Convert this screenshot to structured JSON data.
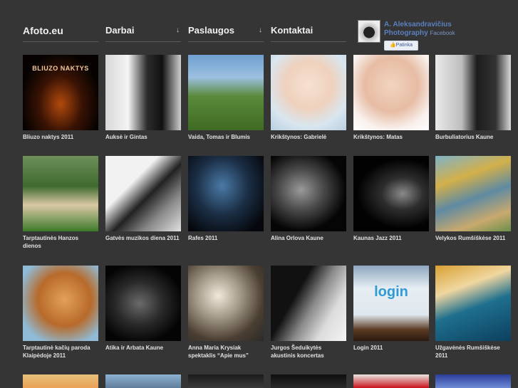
{
  "nav": {
    "logo": "Afoto.eu",
    "items": [
      {
        "label": "Darbai",
        "arrow": "↓"
      },
      {
        "label": "Paslaugos",
        "arrow": "↓"
      },
      {
        "label": "Kontaktai",
        "arrow": ""
      }
    ]
  },
  "facebook": {
    "name": "A. Aleksandravičius Photography",
    "source": "Facebook",
    "like_label": "Patinka"
  },
  "thumb_overlays": {
    "bliuzo": "BLIUZO NAKTYS",
    "login": "login"
  },
  "gallery": [
    {
      "caption": "Bliuzo naktys 2011"
    },
    {
      "caption": "Auksė ir Gintas"
    },
    {
      "caption": "Vaida, Tomas ir Blumis"
    },
    {
      "caption": "Krikštynos: Gabrielė"
    },
    {
      "caption": "Krikštynos: Matas"
    },
    {
      "caption": "Burbuliatorius Kaune"
    },
    {
      "caption": "Tarptautinės Hanzos dienos"
    },
    {
      "caption": "Gatvės muzikos diena 2011"
    },
    {
      "caption": "Rafes 2011"
    },
    {
      "caption": "Alina Orlova Kaune"
    },
    {
      "caption": "Kaunas Jazz 2011"
    },
    {
      "caption": "Velykos Rumšiškėse 2011"
    },
    {
      "caption": "Tarptautinė kačių paroda Klaipėdoje 2011"
    },
    {
      "caption": "Atika ir Arbata Kaune"
    },
    {
      "caption": "Anna Maria Krysiak spektaklis “Apie mus”"
    },
    {
      "caption": "Jurgos Šeduikytės akustinis koncertas"
    },
    {
      "caption": "Login 2011"
    },
    {
      "caption": "Užgavėnės Rumšiškėse 2011"
    },
    {
      "caption": ""
    },
    {
      "caption": ""
    },
    {
      "caption": ""
    },
    {
      "caption": ""
    },
    {
      "caption": ""
    },
    {
      "caption": ""
    }
  ]
}
